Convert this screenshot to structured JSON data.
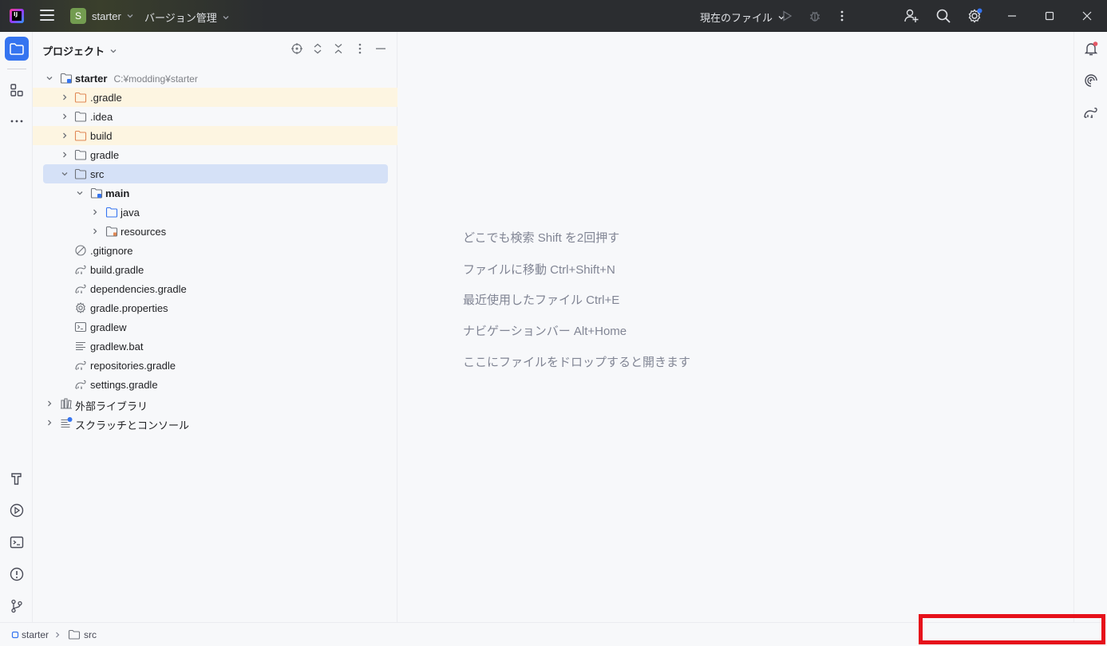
{
  "titlebar": {
    "project_initial": "S",
    "project_name": "starter",
    "vcs_label": "バージョン管理",
    "run_config": "現在のファイル",
    "accent_colors": {
      "project_badge": "#739c50",
      "settings_dot": "#3574f0",
      "notification_dot": "#e55765"
    }
  },
  "panel": {
    "title": "プロジェクト"
  },
  "tree": {
    "root": {
      "name": "starter",
      "path": "C:¥modding¥starter"
    },
    "items": [
      {
        "name": ".gradle"
      },
      {
        "name": ".idea"
      },
      {
        "name": "build"
      },
      {
        "name": "gradle"
      },
      {
        "name": "src"
      },
      {
        "name": "main"
      },
      {
        "name": "java"
      },
      {
        "name": "resources"
      },
      {
        "name": ".gitignore"
      },
      {
        "name": "build.gradle"
      },
      {
        "name": "dependencies.gradle"
      },
      {
        "name": "gradle.properties"
      },
      {
        "name": "gradlew"
      },
      {
        "name": "gradlew.bat"
      },
      {
        "name": "repositories.gradle"
      },
      {
        "name": "settings.gradle"
      },
      {
        "name": "外部ライブラリ"
      },
      {
        "name": "スクラッチとコンソール"
      }
    ]
  },
  "editor": {
    "hints": [
      "どこでも検索 Shift を2回押す",
      "ファイルに移動 Ctrl+Shift+N",
      "最近使用したファイル Ctrl+E",
      "ナビゲーションバー Alt+Home",
      "ここにファイルをドロップすると開きます"
    ]
  },
  "statusbar": {
    "breadcrumb": [
      "starter",
      "src"
    ]
  }
}
